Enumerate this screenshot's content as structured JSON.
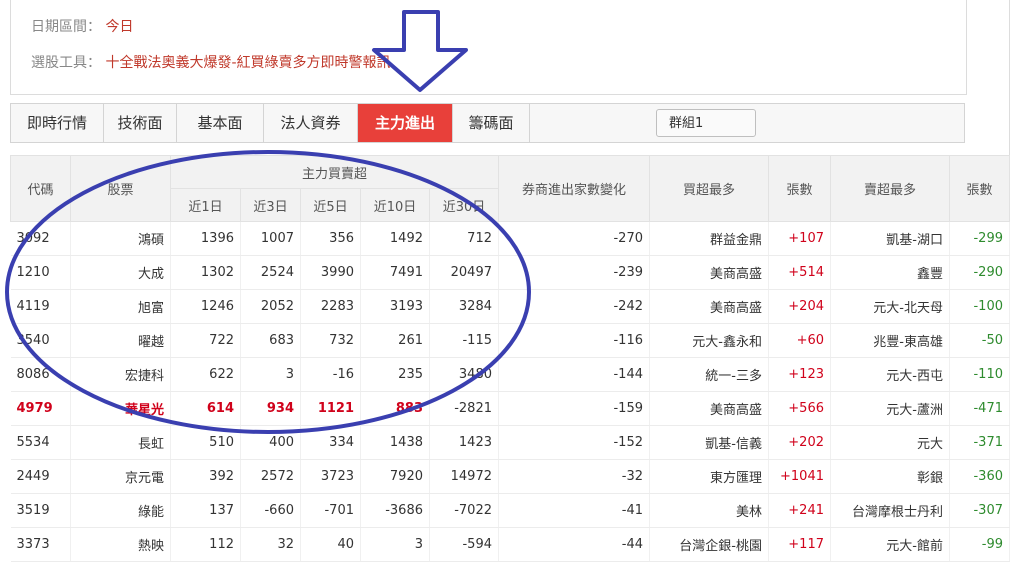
{
  "filters": {
    "date_label": "日期區間：",
    "date_value": "今日",
    "strategy_label": "選股工具：",
    "strategy_value": "十全戰法奧義大爆發-紅買綠賣多方即時警報訊"
  },
  "tabs": [
    {
      "label": "即時行情"
    },
    {
      "label": "技術面"
    },
    {
      "label": "基本面"
    },
    {
      "label": "法人資券"
    },
    {
      "label": "主力進出",
      "active": true
    },
    {
      "label": "籌碼面"
    }
  ],
  "group_select": "群組1",
  "table": {
    "headers": {
      "code": "代碼",
      "stock": "股票",
      "main_group": "主力買賣超",
      "d1": "近1日",
      "d3": "近3日",
      "d5": "近5日",
      "d10": "近10日",
      "d30": "近30日",
      "broker_change": "券商進出家數變化",
      "top_buyer": "買超最多",
      "buy_lots": "張數",
      "top_seller": "賣超最多",
      "sell_lots": "張數"
    },
    "rows": [
      {
        "code": "3092",
        "name": "鴻碩",
        "d1": "1396",
        "d3": "1007",
        "d5": "356",
        "d10": "1492",
        "d30": "712",
        "change": "-270",
        "buyer": "群益金鼎",
        "buy": "+107",
        "seller": "凱基-湖口",
        "sell": "-299"
      },
      {
        "code": "1210",
        "name": "大成",
        "d1": "1302",
        "d3": "2524",
        "d5": "3990",
        "d10": "7491",
        "d30": "20497",
        "change": "-239",
        "buyer": "美商高盛",
        "buy": "+514",
        "seller": "鑫豐",
        "sell": "-290"
      },
      {
        "code": "4119",
        "name": "旭富",
        "d1": "1246",
        "d3": "2052",
        "d5": "2283",
        "d10": "3193",
        "d30": "3284",
        "change": "-242",
        "buyer": "美商高盛",
        "buy": "+204",
        "seller": "元大-北天母",
        "sell": "-100"
      },
      {
        "code": "3540",
        "name": "曜越",
        "d1": "722",
        "d3": "683",
        "d5": "732",
        "d10": "261",
        "d30": "-115",
        "change": "-116",
        "buyer": "元大-鑫永和",
        "buy": "+60",
        "seller": "兆豐-東高雄",
        "sell": "-50"
      },
      {
        "code": "8086",
        "name": "宏捷科",
        "d1": "622",
        "d3": "3",
        "d5": "-16",
        "d10": "235",
        "d30": "3480",
        "change": "-144",
        "buyer": "統一-三多",
        "buy": "+123",
        "seller": "元大-西屯",
        "sell": "-110"
      },
      {
        "code": "4979",
        "name": "華星光",
        "d1": "614",
        "d3": "934",
        "d5": "1121",
        "d10": "883",
        "d30": "-2821",
        "change": "-159",
        "buyer": "美商高盛",
        "buy": "+566",
        "seller": "元大-蘆洲",
        "sell": "-471",
        "highlight": true
      },
      {
        "code": "5534",
        "name": "長虹",
        "d1": "510",
        "d3": "400",
        "d5": "334",
        "d10": "1438",
        "d30": "1423",
        "change": "-152",
        "buyer": "凱基-信義",
        "buy": "+202",
        "seller": "元大",
        "sell": "-371"
      },
      {
        "code": "2449",
        "name": "京元電",
        "d1": "392",
        "d3": "2572",
        "d5": "3723",
        "d10": "7920",
        "d30": "14972",
        "change": "-32",
        "buyer": "東方匯理",
        "buy": "+1041",
        "seller": "彰銀",
        "sell": "-360"
      },
      {
        "code": "3519",
        "name": "綠能",
        "d1": "137",
        "d3": "-660",
        "d5": "-701",
        "d10": "-3686",
        "d30": "-7022",
        "change": "-41",
        "buyer": "美林",
        "buy": "+241",
        "seller": "台灣摩根士丹利",
        "sell": "-307"
      },
      {
        "code": "3373",
        "name": "熱映",
        "d1": "112",
        "d3": "32",
        "d5": "40",
        "d10": "3",
        "d30": "-594",
        "change": "-44",
        "buyer": "台灣企銀-桃園",
        "buy": "+117",
        "seller": "元大-館前",
        "sell": "-99"
      }
    ]
  },
  "annotation": {
    "arrow_color": "#3a3fb0",
    "ellipse_color": "#3a3fb0"
  }
}
